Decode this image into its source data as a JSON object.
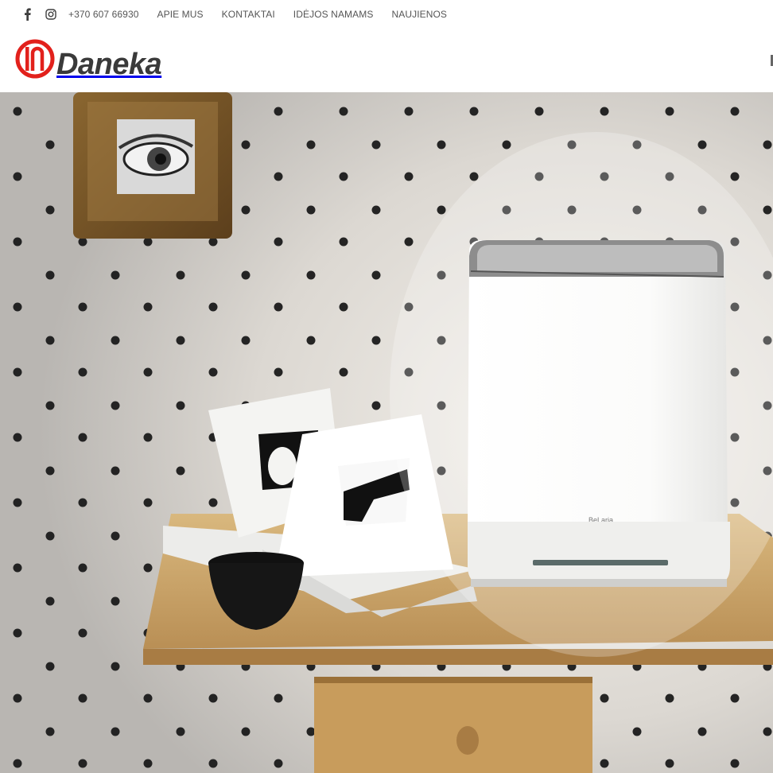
{
  "topbar": {
    "social": [
      {
        "icon": "facebook-icon",
        "label": "f"
      },
      {
        "icon": "instagram-icon"
      }
    ],
    "links": [
      {
        "label": "+370 607 66930"
      },
      {
        "label": "APIE MUS"
      },
      {
        "label": "KONTAKTAI"
      },
      {
        "label": "IDĖJOS NAMAMS"
      },
      {
        "label": "NAUJIENOS"
      }
    ]
  },
  "header": {
    "logo_text": "Daneka",
    "logo_color": "#e2211c"
  },
  "hero": {
    "product_label": "BeLaria"
  }
}
